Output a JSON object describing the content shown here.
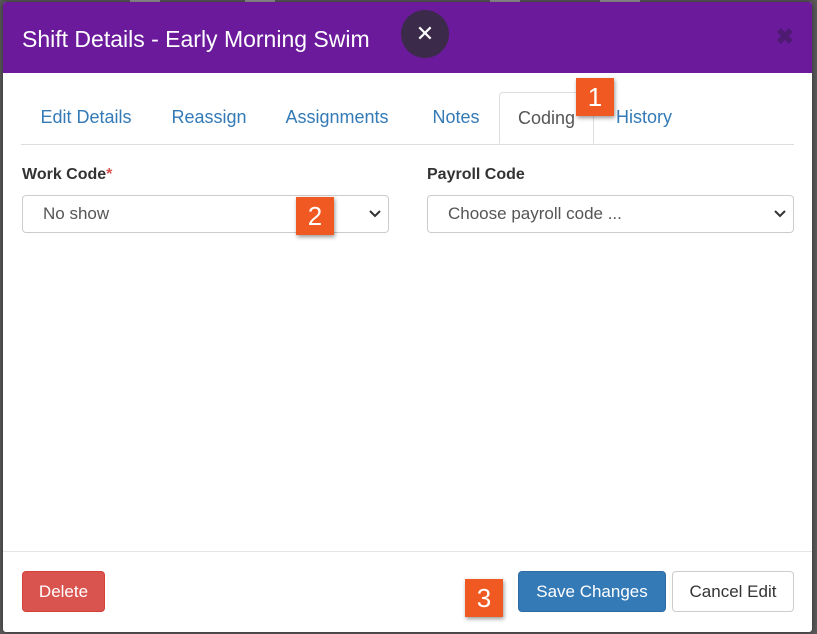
{
  "modal": {
    "title": "Shift Details - Early Morning Swim",
    "close_glyph": "✕",
    "corner_glyph": "✖"
  },
  "tabs": [
    {
      "label": "Edit Details",
      "active": false
    },
    {
      "label": "Reassign",
      "active": false
    },
    {
      "label": "Assignments",
      "active": false
    },
    {
      "label": "Notes",
      "active": false
    },
    {
      "label": "Coding",
      "active": true
    },
    {
      "label": "History",
      "active": false
    }
  ],
  "form": {
    "work_code_label": "Work Code",
    "required_marker": "*",
    "work_code_value": "No show",
    "payroll_code_label": "Payroll Code",
    "payroll_code_value": "Choose payroll code ..."
  },
  "footer": {
    "delete_label": "Delete",
    "save_label": "Save Changes",
    "cancel_label": "Cancel Edit"
  },
  "callouts": [
    "1",
    "2",
    "3"
  ],
  "colors": {
    "header": "#6b1a9c",
    "link": "#337ab7",
    "danger": "#d9534f",
    "callout": "#f05a22"
  },
  "icons": {
    "close": "close-icon",
    "select_arrow": "chevron-down-icon"
  }
}
